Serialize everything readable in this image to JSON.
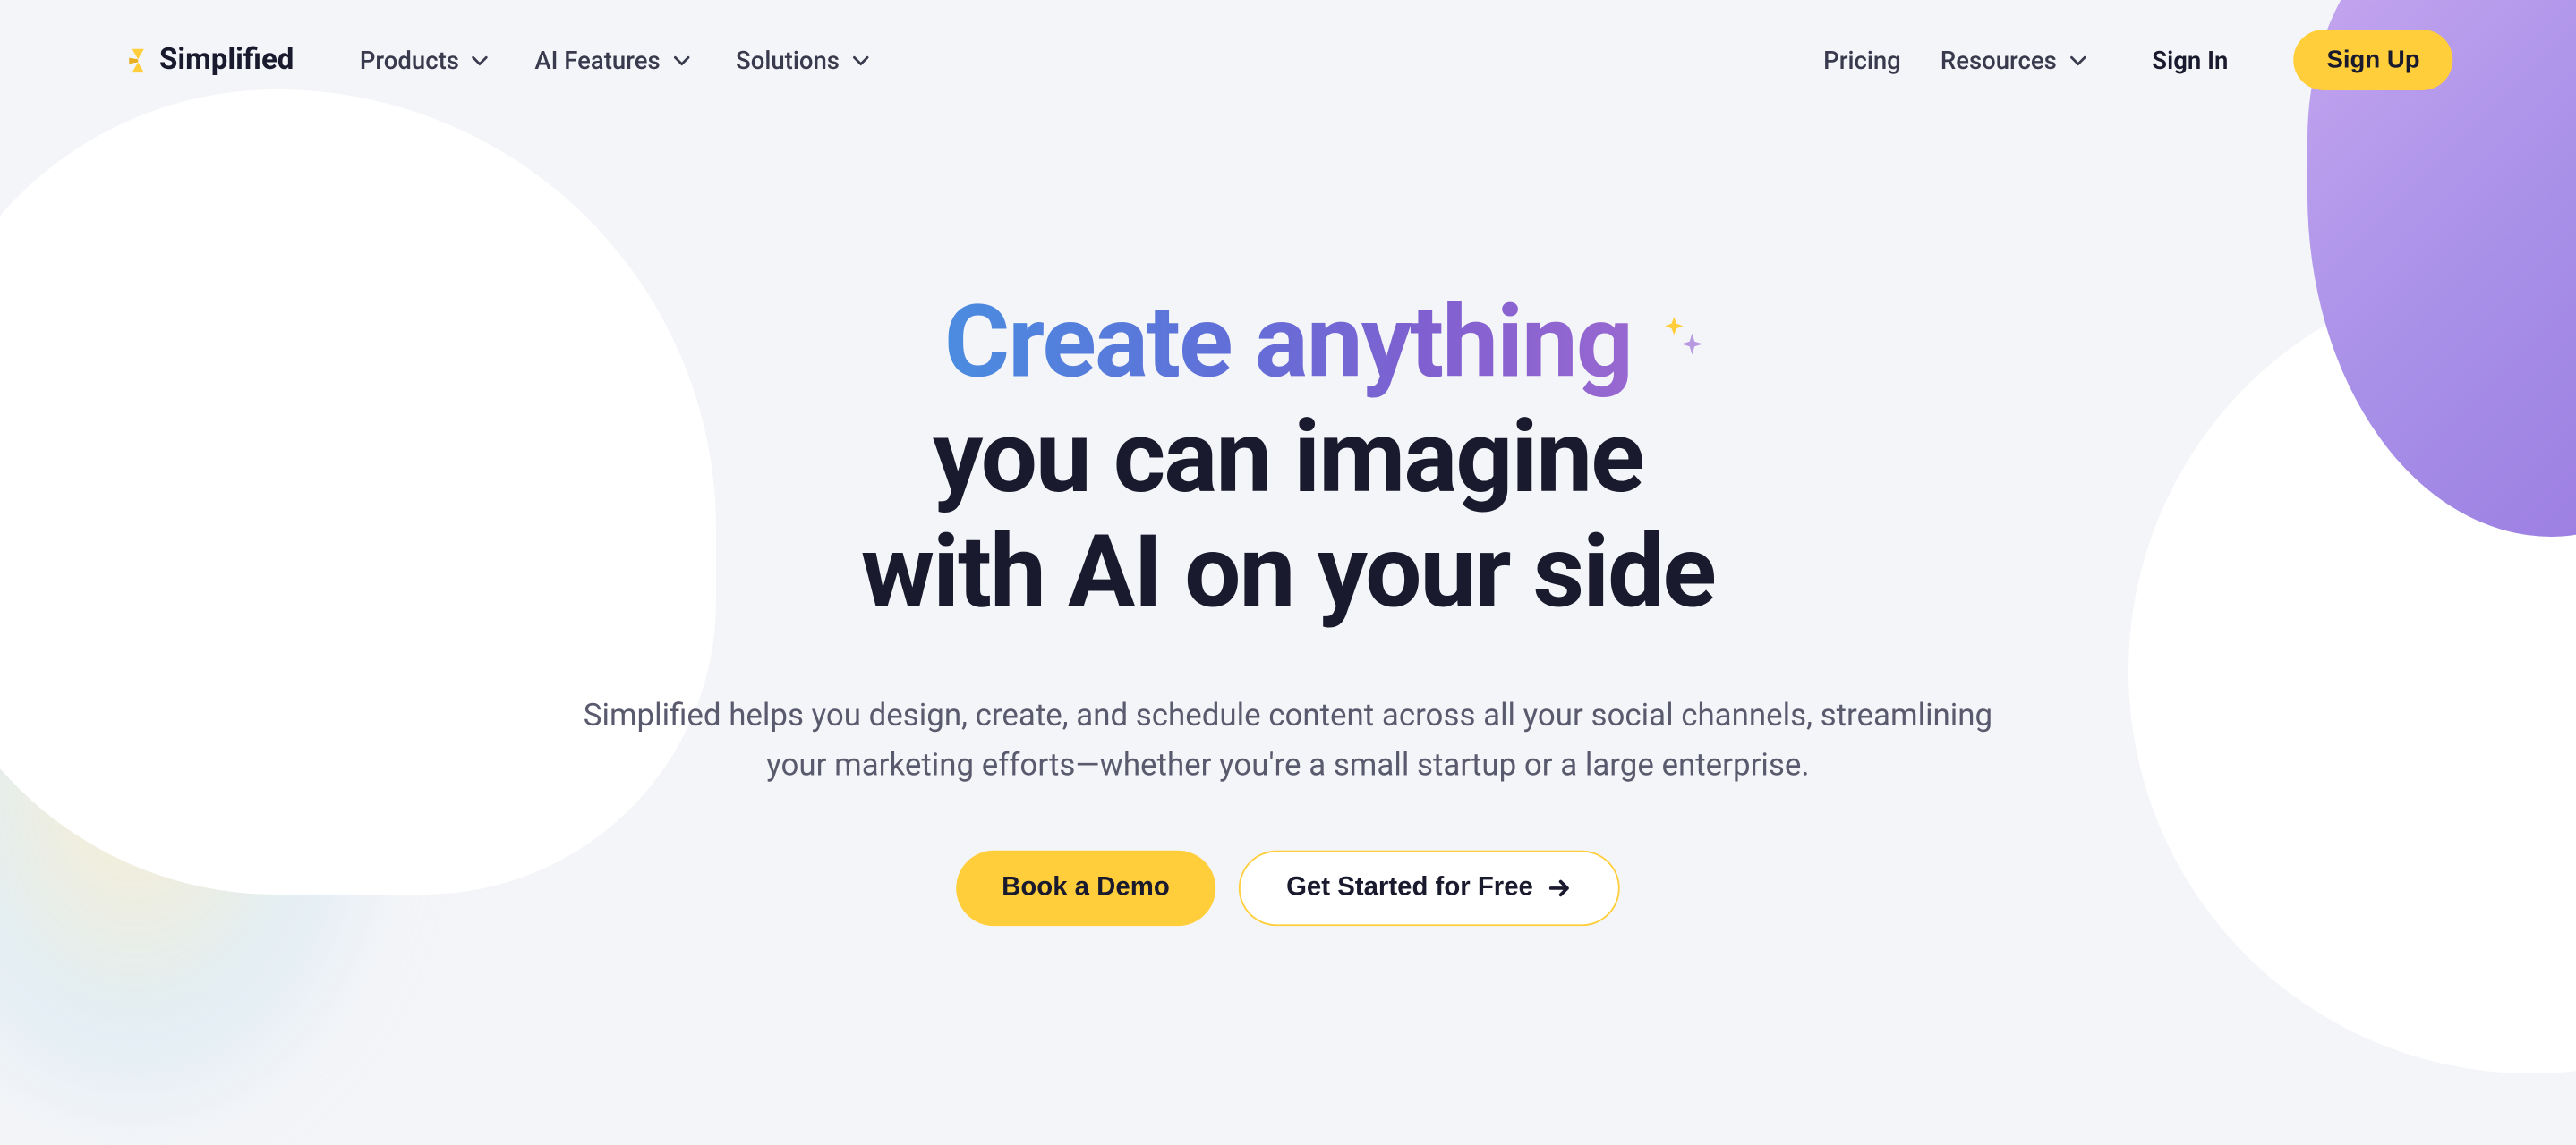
{
  "brand": {
    "name": "Simplified"
  },
  "nav": {
    "menu": [
      {
        "label": "Products"
      },
      {
        "label": "AI Features"
      },
      {
        "label": "Solutions"
      }
    ],
    "pricing": "Pricing",
    "resources": "Resources",
    "signin": "Sign In",
    "signup": "Sign Up"
  },
  "hero": {
    "title_gradient": "Create anything",
    "title_line2": "you can imagine",
    "title_line3": "with AI on your side",
    "subtitle": "Simplified helps you design, create, and schedule content across all your social channels, streamlining your marketing efforts—whether you're a small startup or a large enterprise.",
    "cta_demo": "Book a Demo",
    "cta_start": "Get Started for Free"
  },
  "colors": {
    "accent": "#ffce3a",
    "text_primary": "#1a1a2e",
    "text_secondary": "#5a5a6e",
    "gradient_start": "#4a8ce0",
    "gradient_end": "#9868d0"
  }
}
